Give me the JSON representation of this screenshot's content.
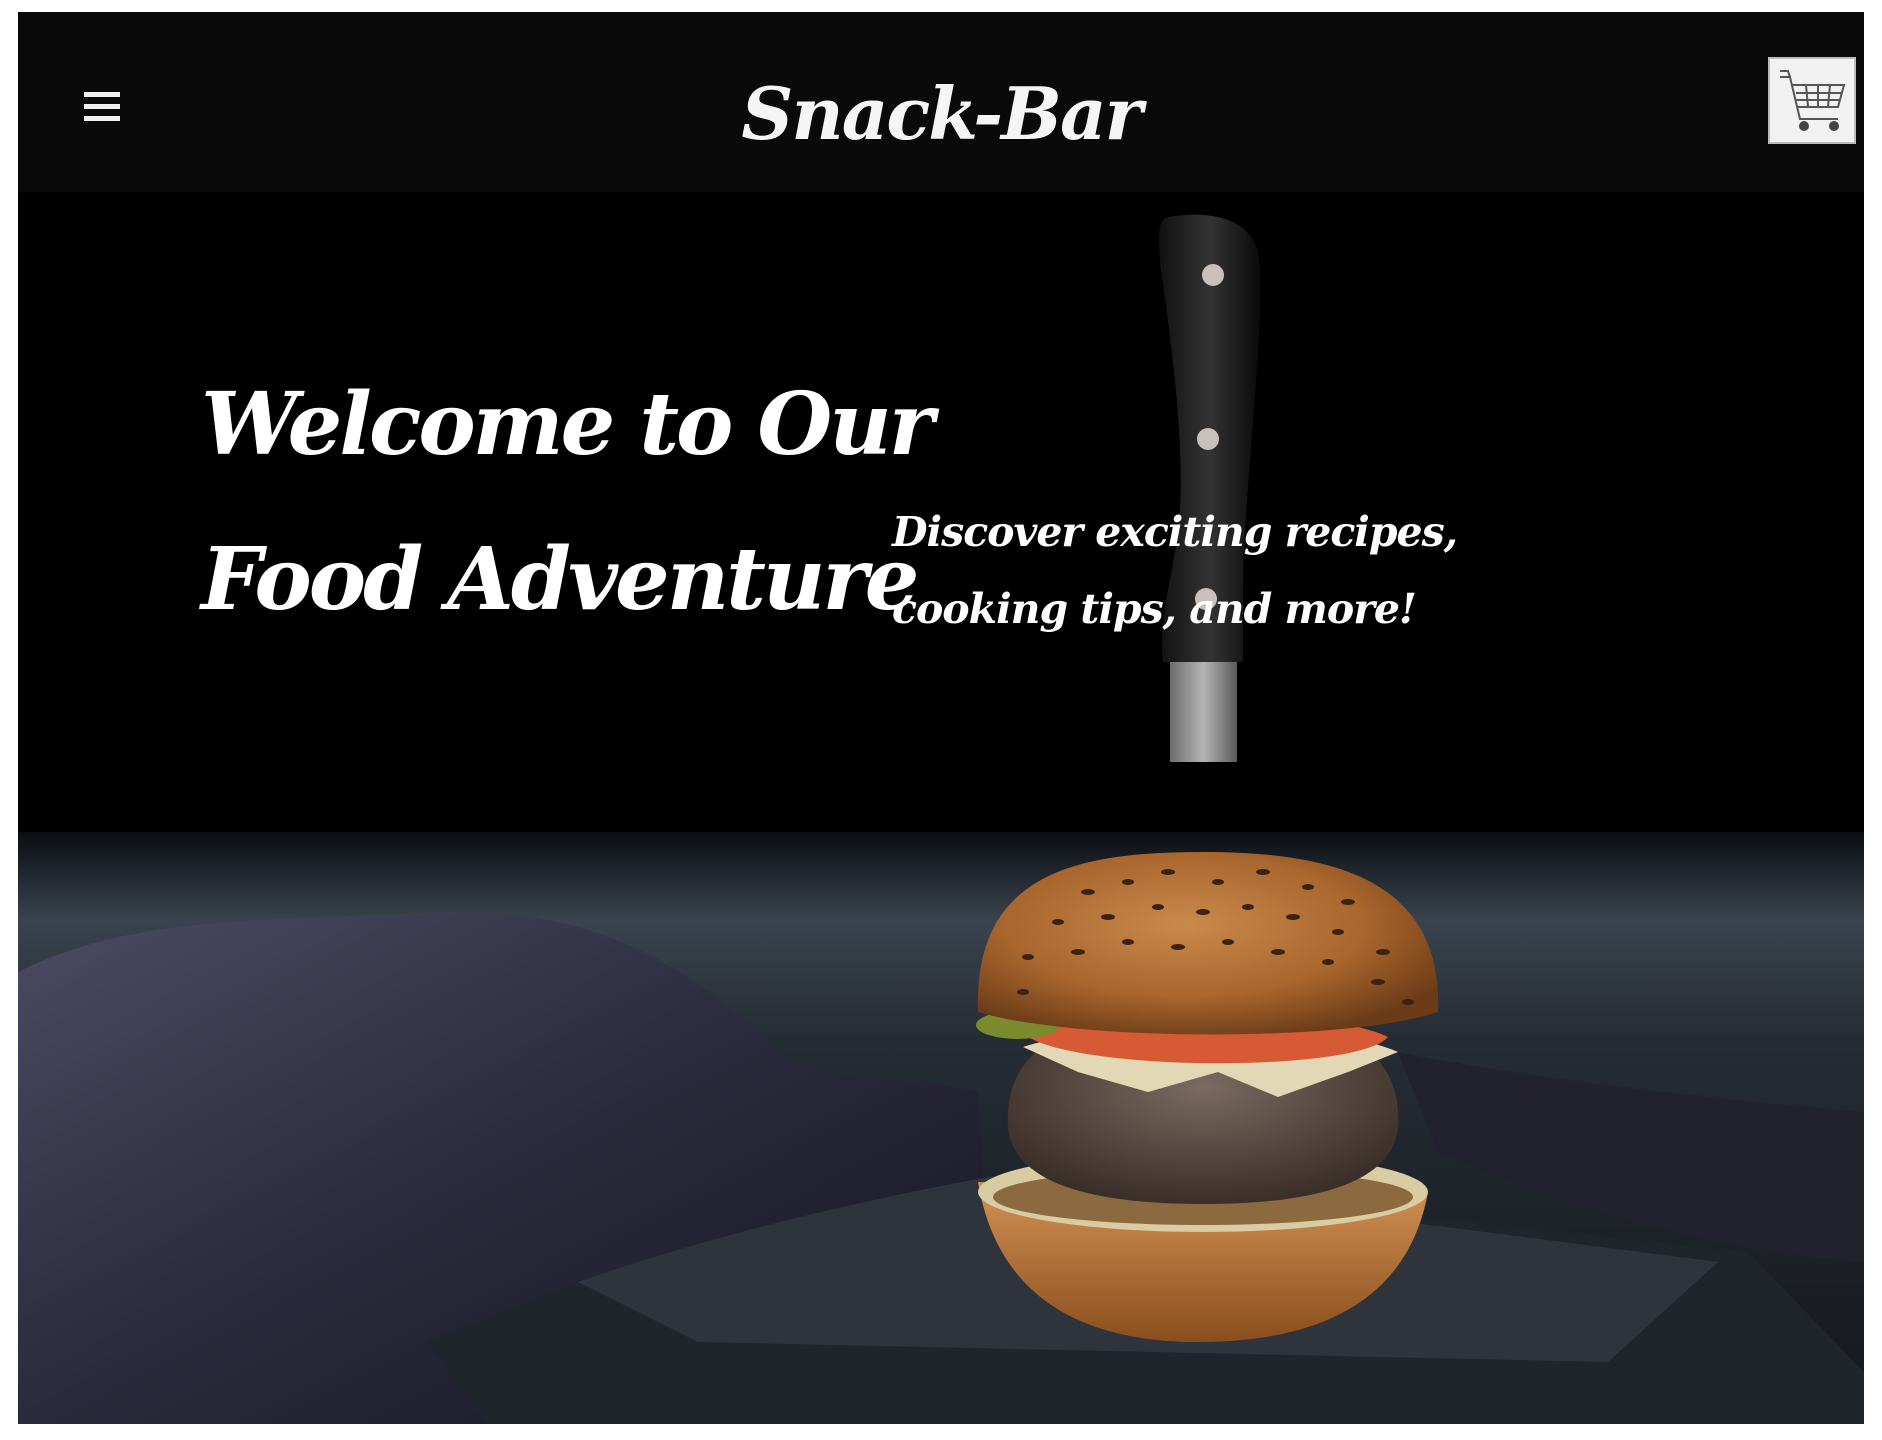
{
  "header": {
    "brand": "Snack-Bar",
    "menu_icon": "hamburger-menu-icon",
    "cart_icon": "shopping-cart-icon"
  },
  "hero": {
    "title": "Welcome to Our Food Adventure",
    "subtitle": "Discover exciting recipes, cooking tips, and more!",
    "image": "burger-with-knife-on-slate"
  },
  "colors": {
    "header_bg": "#0a0a0a",
    "text": "#ffffff",
    "cart_bg": "#f1f1f1"
  }
}
